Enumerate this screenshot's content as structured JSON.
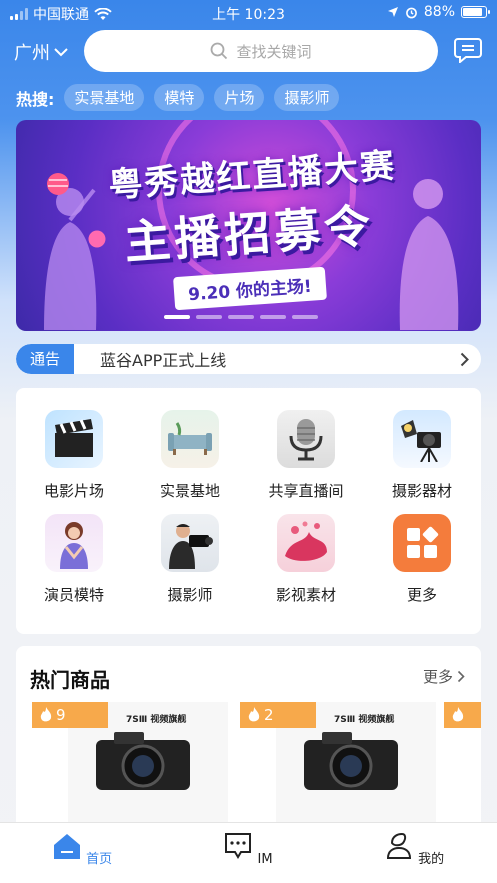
{
  "status_bar": {
    "carrier": "中国联通",
    "time": "上午 10:23",
    "battery": "88%",
    "battery_level": 0.88
  },
  "header": {
    "city": "广州",
    "search_placeholder": "查找关键词"
  },
  "hot_search": {
    "label": "热搜:",
    "tags": [
      "实景基地",
      "模特",
      "片场",
      "摄影师"
    ]
  },
  "banner": {
    "line1": "粤秀越红直播大赛",
    "line2": "主播招募令",
    "slogan": "9.20 你的主场!",
    "slide_count": 5,
    "active_slide": 0
  },
  "notice": {
    "tag": "通告",
    "text": "蓝谷APP正式上线"
  },
  "categories": [
    {
      "label": "电影片场",
      "icon": "clapperboard-icon"
    },
    {
      "label": "实景基地",
      "icon": "living-room-icon"
    },
    {
      "label": "共享直播间",
      "icon": "microphone-icon"
    },
    {
      "label": "摄影器材",
      "icon": "camera-equipment-icon"
    },
    {
      "label": "演员模特",
      "icon": "model-icon"
    },
    {
      "label": "摄影师",
      "icon": "videographer-icon"
    },
    {
      "label": "影视素材",
      "icon": "splash-icon"
    },
    {
      "label": "更多",
      "icon": "more-grid-icon"
    }
  ],
  "hot_goods": {
    "title": "热门商品",
    "more": "更多",
    "items": [
      {
        "heat": "9",
        "header_text": "7SⅢ 视频旗舰"
      },
      {
        "heat": "2",
        "header_text": "7SⅢ 视频旗舰"
      }
    ]
  },
  "tabs": [
    {
      "label": "首页",
      "active": true,
      "icon": "home-icon"
    },
    {
      "label": "IM",
      "active": false,
      "icon": "chat-icon"
    },
    {
      "label": "我的",
      "active": false,
      "icon": "user-icon"
    }
  ],
  "colors": {
    "primary": "#3a86ea",
    "heat_badge": "#f7a94b",
    "more_tile": "#f47c3c"
  }
}
